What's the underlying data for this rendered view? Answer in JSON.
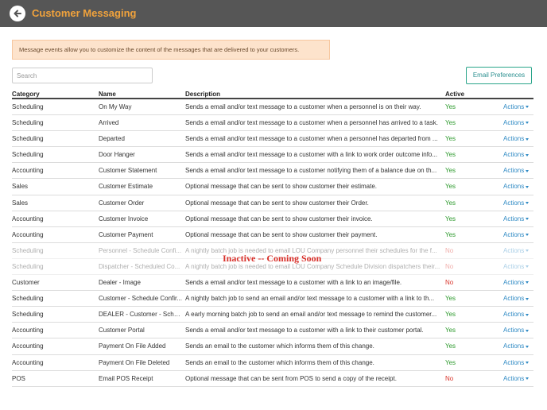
{
  "header": {
    "title": "Customer Messaging"
  },
  "notice": "Message events allow you to customize the content of the messages that are delivered to your customers.",
  "search": {
    "placeholder": "Search"
  },
  "email_preferences_label": "Email Preferences",
  "columns": {
    "category": "Category",
    "name": "Name",
    "description": "Description",
    "active": "Active"
  },
  "actions_label": "Actions",
  "overlay_text": "Inactive -- Coming Soon",
  "colors": {
    "topbar": "#565656",
    "title": "#f0a23c",
    "yes": "#2d9a2d",
    "no": "#d9342b",
    "link": "#2f8ac4"
  },
  "rows": [
    {
      "category": "Scheduling",
      "name": "On My Way",
      "description": "Sends a email and/or text message to a customer when a personnel is on their way.",
      "active": "Yes"
    },
    {
      "category": "Scheduling",
      "name": "Arrived",
      "description": "Sends a email and/or text message to a customer when a personnel has arrived to a task.",
      "active": "Yes"
    },
    {
      "category": "Scheduling",
      "name": "Departed",
      "description": "Sends a email and/or text message to a customer when a personnel has departed from ...",
      "active": "Yes"
    },
    {
      "category": "Scheduling",
      "name": "Door Hanger",
      "description": "Sends a email and/or text message to a customer with a link to work order outcome info...",
      "active": "Yes"
    },
    {
      "category": "Accounting",
      "name": "Customer Statement",
      "description": "Sends a email and/or text message to a customer notifying them of a balance due on th...",
      "active": "Yes"
    },
    {
      "category": "Sales",
      "name": "Customer Estimate",
      "description": "Optional message that can be sent to show customer their estimate.",
      "active": "Yes"
    },
    {
      "category": "Sales",
      "name": "Customer Order",
      "description": "Optional message that can be sent to show customer their Order.",
      "active": "Yes"
    },
    {
      "category": "Accounting",
      "name": "Customer Invoice",
      "description": "Optional message that can be sent to show customer their invoice.",
      "active": "Yes"
    },
    {
      "category": "Accounting",
      "name": "Customer Payment",
      "description": "Optional message that can be sent to show customer their payment.",
      "active": "Yes"
    },
    {
      "category": "Scheduling",
      "name": "Personnel - Schedule Confi...",
      "description": "A nightly batch job is needed to email LOU Company personnel their schedules for the f...",
      "active": "No",
      "faded": true
    },
    {
      "category": "Scheduling",
      "name": "Dispatcher - Scheduled Co...",
      "description": "A nightly batch job is needed to email LOU Company Schedule Division dispatchers their...",
      "active": "No",
      "faded": true
    },
    {
      "category": "Customer",
      "name": "Dealer - Image",
      "description": "Sends a email and/or text message to a customer with a link to an image/file.",
      "active": "No"
    },
    {
      "category": "Scheduling",
      "name": "Customer - Schedule Confir...",
      "description": "A nightly batch job to send an email and/or text message to a customer with a link to th...",
      "active": "Yes"
    },
    {
      "category": "Scheduling",
      "name": "DEALER - Customer - Sche...",
      "description": "A early morning batch job to send an email and/or text message to remind the customer...",
      "active": "Yes"
    },
    {
      "category": "Accounting",
      "name": "Customer Portal",
      "description": "Sends a email and/or text message to a customer with a link to their customer portal.",
      "active": "Yes"
    },
    {
      "category": "Accounting",
      "name": "Payment On File Added",
      "description": "Sends an email to the customer which informs them of this change.",
      "active": "Yes"
    },
    {
      "category": "Accounting",
      "name": "Payment On File Deleted",
      "description": "Sends an email to the customer which informs them of this change.",
      "active": "Yes"
    },
    {
      "category": "POS",
      "name": "Email POS Receipt",
      "description": "Optional message that can be sent from POS to send a copy of the receipt.",
      "active": "No"
    }
  ]
}
